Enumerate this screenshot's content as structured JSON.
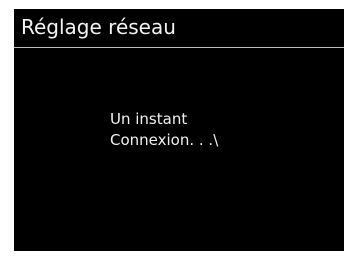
{
  "screen": {
    "title": "Réglage réseau",
    "message": {
      "line1": "Un instant",
      "line2": "Connexion. . .\\"
    }
  },
  "colors": {
    "background": "#000000",
    "text": "#f0f0f0",
    "divider": "#bdbdbd"
  }
}
